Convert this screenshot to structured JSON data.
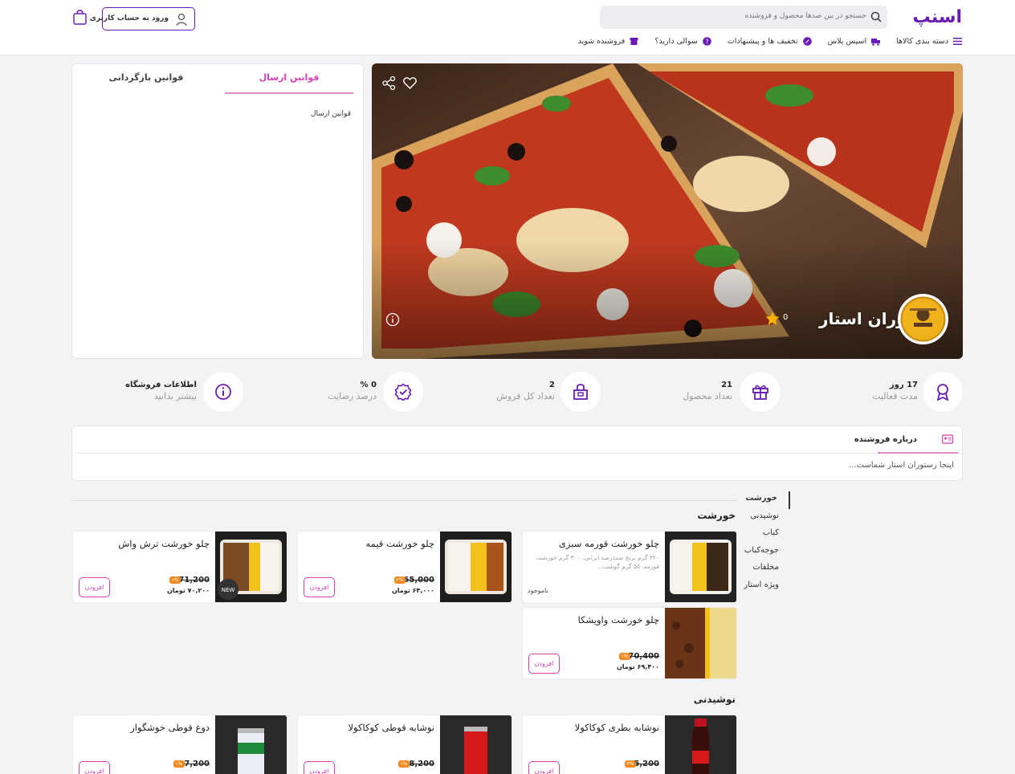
{
  "header": {
    "logo": "اسنپ",
    "search_placeholder": "جستجو در بین صدها محصول و فروشنده",
    "login_label": "ورود به حساب کاربری",
    "nav": [
      {
        "label": "دسته بندی کالاها",
        "icon": "menu-icon"
      },
      {
        "label": "اسپس پلاس",
        "icon": "truck-icon"
      },
      {
        "label": "تخفیف ها و پیشنهادات",
        "icon": "percent-badge-icon"
      },
      {
        "label": "سوالی دارید؟",
        "icon": "question-icon"
      },
      {
        "label": "فروشنده شوید",
        "icon": "store-icon"
      }
    ]
  },
  "rules_panel": {
    "tab_shipping": "قوانین ارسال",
    "tab_return": "قوانین بازگردانی",
    "body": "قوانین ارسال"
  },
  "hero": {
    "title": "رستوران استار",
    "rating": "0"
  },
  "stats": [
    {
      "value": "17 روز",
      "label": "مدت فعالیت",
      "icon": "award-icon"
    },
    {
      "value": "21",
      "label": "تعداد محصول",
      "icon": "gift-box-icon"
    },
    {
      "value": "2",
      "label": "تعداد کل فروش",
      "icon": "shopping-bag-icon"
    },
    {
      "value": "0 %",
      "label": "درصد رضایت",
      "icon": "verified-icon"
    },
    {
      "value": "اطلاعات فروشگاه",
      "label": "بیشتر بدانید",
      "icon": "info-circle-icon"
    }
  ],
  "about": {
    "title": "درباره فروشنده",
    "text": "اینجا رستوران استار شماست..."
  },
  "categories": [
    "خورشت",
    "نوشیدنی",
    "کباب",
    "جوجه‌کباب",
    "مخلفات",
    "ویژه استار"
  ],
  "sections": {
    "stew": "خورشت",
    "drinks": "نوشیدنی"
  },
  "products": [
    {
      "name": "چلو خورشت قورمه سبزی",
      "desc": "۳۲۰ گرم برنج صددرصد ایرانی، ۳۰۰ گرم خورشت قورمه، ۵۵ گرم گوشت...",
      "status": "ناموجود"
    },
    {
      "name": "چلو خورشت قیمه",
      "old_price": "65,000",
      "discount": "۲%",
      "new_price": "۶۴,۰۰۰ تومان",
      "add": "افزودن"
    },
    {
      "name": "چلو خورشت ترش واش",
      "old_price": "71,200",
      "discount": "۱%",
      "new_price": "۷۰,۲۰۰ تومان",
      "add": "افزودن"
    },
    {
      "name": "چلو خورشت واویشکا",
      "old_price": "70,400",
      "discount": "۱%",
      "new_price": "۶۹,۴۰۰ تومان",
      "add": "افزودن"
    },
    {
      "name": "نوشابه بطری کوکاکولا",
      "old_price": "5,200",
      "discount": "۴%",
      "add": "افزودن"
    },
    {
      "name": "نوشابه قوطی کوکاکولا",
      "old_price": "8,200",
      "discount": "۱%",
      "add": "افزودن"
    },
    {
      "name": "دوغ قوطی خوشگوار",
      "old_price": "7,200",
      "discount": "۱%",
      "add": "افزودن"
    }
  ],
  "colors": {
    "brand": "#6a1bb5",
    "accent": "#d63fb8",
    "discount": "#f28a1f"
  }
}
